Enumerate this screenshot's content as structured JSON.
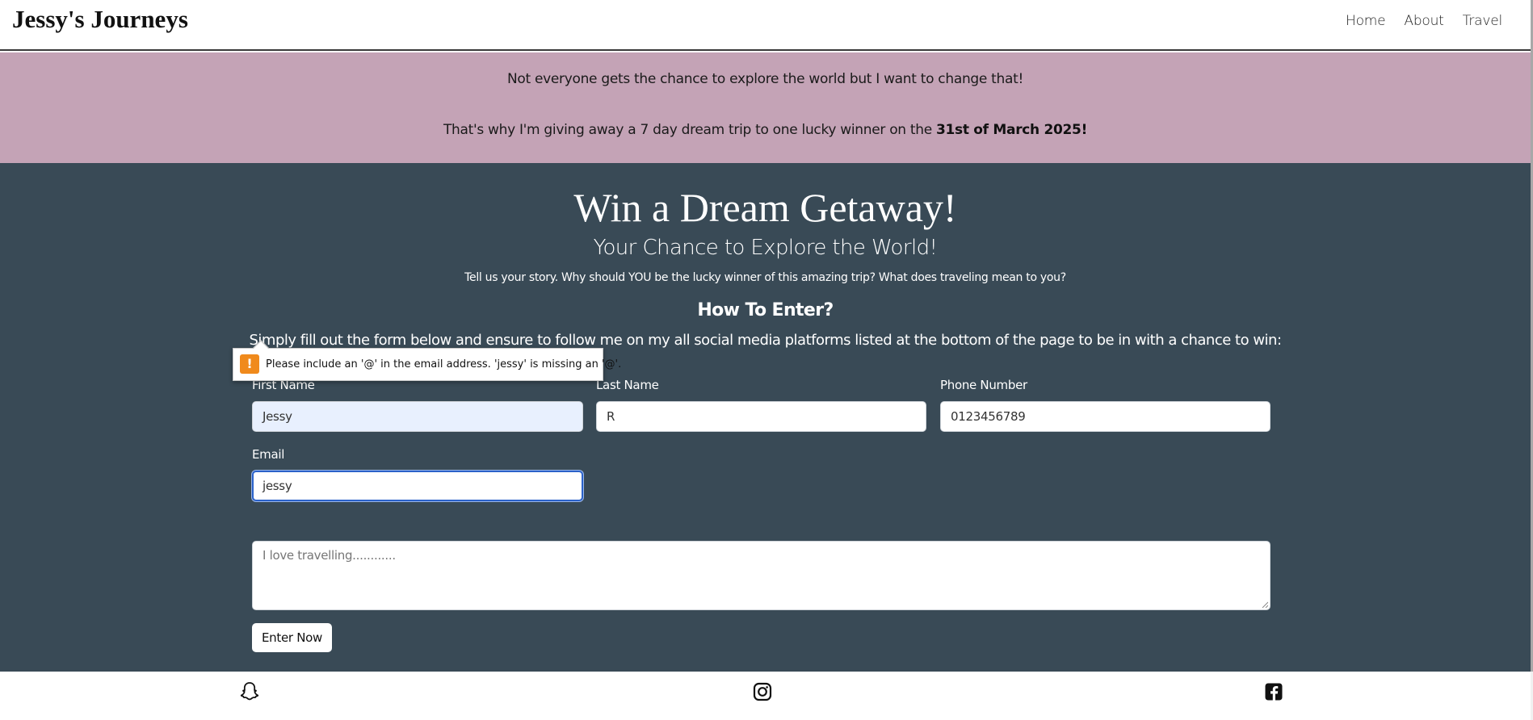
{
  "header": {
    "brand": "Jessy's Journeys",
    "nav": [
      "Home",
      "About",
      "Travel"
    ]
  },
  "promo": {
    "line1": "Not everyone gets the chance to explore the world but I want to change that!",
    "line2_prefix": "That's why I'm giving away a 7 day dream trip to one lucky winner on the ",
    "line2_date": "31st of March 2025!"
  },
  "hero": {
    "title": "Win a Dream Getaway!",
    "subtitle": "Your Chance to Explore the World!",
    "story": "Tell us your story. Why should YOU be the lucky winner of this amazing trip? What does traveling mean to you?",
    "how_heading": "How To Enter?",
    "instructions": "Simply fill out the form below and ensure to follow me on my all social media platforms listed at the bottom of the page to be in with a chance to win:"
  },
  "form": {
    "first_name": {
      "label": "First Name",
      "value": "Jessy"
    },
    "last_name": {
      "label": "Last Name",
      "value": "R"
    },
    "phone": {
      "label": "Phone Number",
      "value": "0123456789"
    },
    "email": {
      "label": "Email",
      "value": "jessy"
    },
    "message": {
      "value": "I love travelling............"
    },
    "submit_label": "Enter Now"
  },
  "validation": {
    "message": "Please include an '@' in the email address. 'jessy' is missing an '@'.",
    "icon": "warning-icon",
    "icon_color": "#f08a1c"
  },
  "footer": {
    "icons": [
      "snapchat-icon",
      "instagram-icon",
      "facebook-icon"
    ]
  },
  "colors": {
    "promo_bg": "#c4a3b6",
    "main_bg": "#394a56",
    "autofill_bg": "#e8f0fe",
    "focus_border": "#2b62c9"
  }
}
